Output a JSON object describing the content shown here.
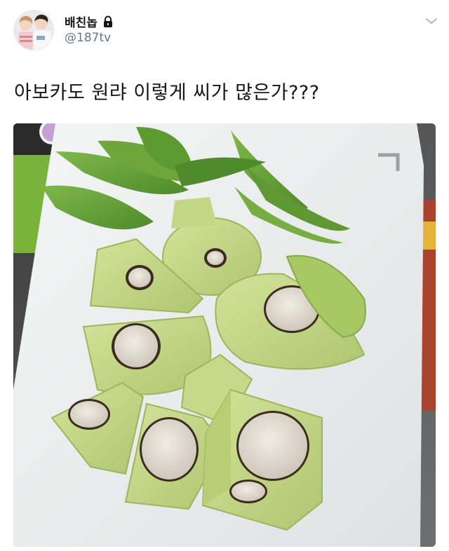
{
  "user": {
    "display_name": "배친놉",
    "handle": "@187tv",
    "icons": {
      "lock": "lock-icon",
      "menu": "chevron-down-icon"
    }
  },
  "tweet": {
    "text": "아보카도 원랴 이렇게 씨가 많은가???"
  },
  "media": {
    "description_icon": "photo",
    "colors": {
      "avocado_flesh": "#c7d88a",
      "avocado_skin": "#6aa23a",
      "seed": "#e6e0d6",
      "board": "#eef0f0"
    }
  }
}
